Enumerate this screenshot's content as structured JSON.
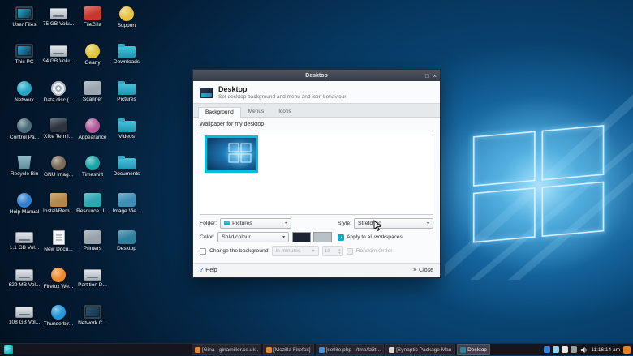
{
  "desktop": {
    "icons": [
      {
        "label": "User Files",
        "kind": "monitor",
        "color": "#27b0c9",
        "icon_name": "user-files-icon"
      },
      {
        "label": "This PC",
        "kind": "monitor",
        "color": "#2d9fd0",
        "icon_name": "this-pc-icon"
      },
      {
        "label": "Network",
        "kind": "circle",
        "color": "#22a8c4",
        "icon_name": "network-icon"
      },
      {
        "label": "Control Pa...",
        "kind": "circle",
        "color": "#4a6b7a",
        "icon_name": "control-panel-icon"
      },
      {
        "label": "Recycle Bin",
        "kind": "bin",
        "color": "#5e8a96",
        "icon_name": "recycle-bin-icon"
      },
      {
        "label": "Help Manual",
        "kind": "circle",
        "color": "#2f7fd0",
        "icon_name": "help-manual-icon"
      },
      {
        "label": "1.1 GB Vol...",
        "kind": "drive",
        "color": "#aab4bc",
        "icon_name": "volume-drive-icon"
      },
      {
        "label": "629 MB Vol...",
        "kind": "drive",
        "color": "#aab4bc",
        "icon_name": "volume-drive-icon"
      },
      {
        "label": "108 GB Vol...",
        "kind": "drive",
        "color": "#aab4bc",
        "icon_name": "volume-drive-icon"
      },
      {
        "label": "75 GB Volu...",
        "kind": "drive",
        "color": "#aab4bc",
        "icon_name": "volume-drive-icon"
      },
      {
        "label": "94 GB Volu...",
        "kind": "drive",
        "color": "#aab4bc",
        "icon_name": "volume-drive-icon"
      },
      {
        "label": "Data disc (...",
        "kind": "disc",
        "color": "#9fb6c4",
        "icon_name": "data-disc-icon"
      },
      {
        "label": "Xfce Termi...",
        "kind": "rect",
        "color": "#2b3440",
        "icon_name": "terminal-icon"
      },
      {
        "label": "GNU Imag...",
        "kind": "circle",
        "color": "#7a6a58",
        "icon_name": "gimp-icon"
      },
      {
        "label": "Install/Rem...",
        "kind": "rect",
        "color": "#b5884a",
        "icon_name": "install-remove-icon"
      },
      {
        "label": "New Docu...",
        "kind": "doc",
        "color": "#f2f4f6",
        "icon_name": "new-document-icon"
      },
      {
        "label": "Firefox We...",
        "kind": "circle",
        "color": "#ef8a2c",
        "icon_name": "firefox-icon"
      },
      {
        "label": "Thunderbir...",
        "kind": "circle",
        "color": "#2397d8",
        "icon_name": "thunderbird-icon"
      },
      {
        "label": "FileZilla",
        "kind": "rect",
        "color": "#c8372d",
        "icon_name": "filezilla-icon"
      },
      {
        "label": "Geany",
        "kind": "circle",
        "color": "#e0c23c",
        "icon_name": "geany-icon"
      },
      {
        "label": "Scanner",
        "kind": "rect",
        "color": "#9aa7b0",
        "icon_name": "scanner-icon"
      },
      {
        "label": "Appearance",
        "kind": "circle",
        "color": "#b05a9a",
        "icon_name": "appearance-icon"
      },
      {
        "label": "Timeshift",
        "kind": "circle",
        "color": "#18a5a8",
        "icon_name": "timeshift-icon"
      },
      {
        "label": "Resource U...",
        "kind": "rect",
        "color": "#2aa8b0",
        "icon_name": "resource-usage-icon"
      },
      {
        "label": "Printers",
        "kind": "rect",
        "color": "#97a2ab",
        "icon_name": "printers-icon"
      },
      {
        "label": "Partition D...",
        "kind": "drive",
        "color": "#aab4bc",
        "icon_name": "partition-drive-icon"
      },
      {
        "label": "Network C...",
        "kind": "monitor",
        "color": "#35506b",
        "icon_name": "network-connections-icon"
      },
      {
        "label": "Support",
        "kind": "circle",
        "color": "#e6c33e",
        "icon_name": "support-icon"
      },
      {
        "label": "Downloads",
        "kind": "folder",
        "color": "#2fa8c0",
        "icon_name": "downloads-folder-icon"
      },
      {
        "label": "Pictures",
        "kind": "folder",
        "color": "#2fa8c0",
        "icon_name": "pictures-folder-icon"
      },
      {
        "label": "Videos",
        "kind": "folder",
        "color": "#2fa8c0",
        "icon_name": "videos-folder-icon"
      },
      {
        "label": "Documents",
        "kind": "folder",
        "color": "#2fa8c0",
        "icon_name": "documents-folder-icon"
      },
      {
        "label": "Image Vie...",
        "kind": "rect",
        "color": "#3d8fb5",
        "icon_name": "image-viewer-icon"
      },
      {
        "label": "Desktop",
        "kind": "rect",
        "color": "#2e7f9e",
        "icon_name": "desktop-settings-icon"
      }
    ]
  },
  "dialog": {
    "window_title": "Desktop",
    "titlebar": {
      "maximize": "□",
      "close": "×"
    },
    "header": {
      "title": "Desktop",
      "subtitle": "Set desktop background and menu and icon behaviour"
    },
    "tabs": [
      {
        "label": "Background",
        "active": true
      },
      {
        "label": "Menus",
        "active": false
      },
      {
        "label": "Icons",
        "active": false
      }
    ],
    "background_tab": {
      "wallpaper_section_label": "Wallpaper for my desktop",
      "folder_label": "Folder:",
      "folder_value": "Pictures",
      "style_label": "Style:",
      "style_value": "Stretched",
      "color_label": "Color:",
      "color_value": "Solid colour",
      "color_swatches": [
        "#1b2430",
        "#b9c0c6"
      ],
      "apply_all_workspaces": {
        "label": "Apply to all workspaces",
        "checked": true
      },
      "change_background": {
        "label": "Change the background",
        "checked": false
      },
      "interval_value": "in minutes",
      "interval_number": "10",
      "random_order": {
        "label": "Random Order",
        "checked": false,
        "disabled": true
      }
    },
    "footer": {
      "help_icon": "?",
      "help_label": "Help",
      "close_icon": "×",
      "close_label": "Close"
    }
  },
  "taskbar": {
    "windows": [
      {
        "label": "[Gina : ginamiller.co.uk...",
        "icon_color": "#e8882a",
        "icon_name": "firefox-icon",
        "active": false
      },
      {
        "label": "[Mozilla Firefox]",
        "icon_color": "#e8882a",
        "icon_name": "firefox-icon",
        "active": false
      },
      {
        "label": "[setlite.php - /tmp/fz3t...",
        "icon_color": "#4a90d9",
        "icon_name": "text-editor-icon",
        "active": false
      },
      {
        "label": "[Synaptic Package Man...",
        "icon_color": "#d8d8d8",
        "icon_name": "synaptic-icon",
        "active": false
      },
      {
        "label": "Desktop",
        "icon_color": "#2e86a0",
        "icon_name": "desktop-settings-icon",
        "active": true
      }
    ],
    "tray_icons": [
      {
        "color": "#2f84d8",
        "icon_name": "tray-icon"
      },
      {
        "color": "#8fd8ec",
        "icon_name": "tray-icon"
      },
      {
        "color": "#e8e8e8",
        "icon_name": "tray-icon"
      },
      {
        "color": "#98a0a8",
        "icon_name": "tray-icon"
      }
    ],
    "clock": "11:16:14 am"
  }
}
